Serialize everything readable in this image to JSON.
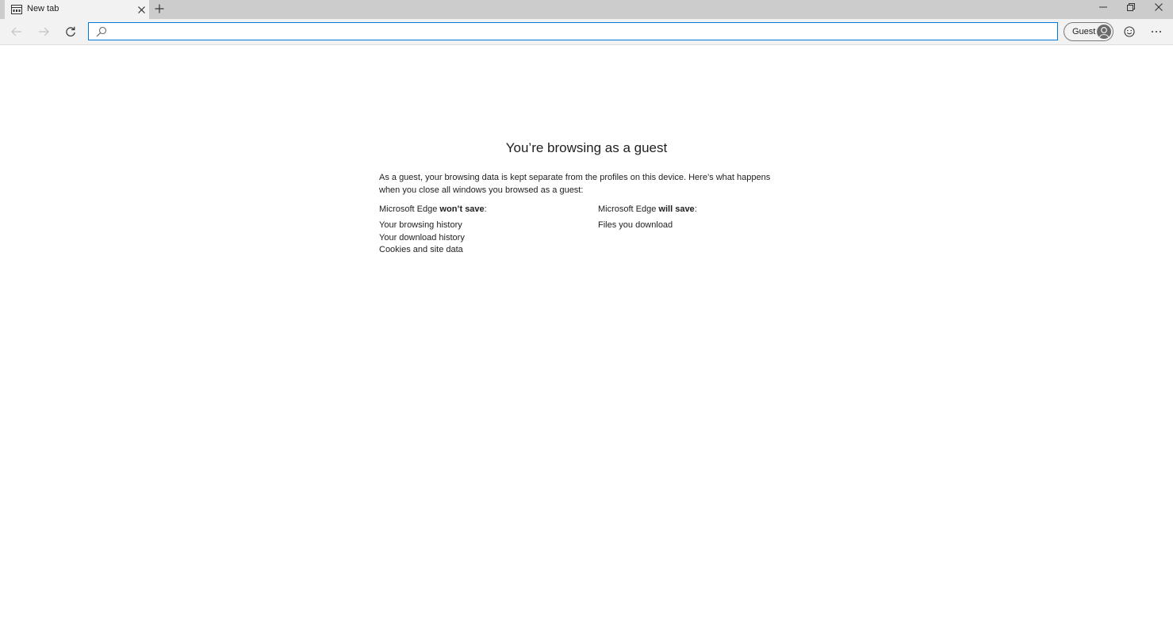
{
  "browser": {
    "tab": {
      "title": "New tab",
      "icon": "newtab-page-icon"
    },
    "new_tab_icon": "plus-icon",
    "window_controls": [
      "minimize-icon",
      "restore-icon",
      "close-icon"
    ],
    "address_bar": {
      "value": "",
      "placeholder": "",
      "icon": "search-icon"
    },
    "profile": {
      "label": "Guest",
      "icon": "avatar-icon"
    },
    "toolbar_icons": [
      "emoji-feedback-icon",
      "more-icon"
    ],
    "accent_color": "#0078d7"
  },
  "page": {
    "title": "You’re browsing as a guest",
    "intro": "As a guest, your browsing data is kept separate from the profiles on this device. Here’s what happens when you close all windows you browsed as a guest:",
    "wont_save": {
      "prefix": "Microsoft Edge ",
      "emphasis": "won’t save",
      "suffix": ":",
      "items": [
        "Your browsing history",
        "Your download history",
        "Cookies and site data"
      ]
    },
    "will_save": {
      "prefix": "Microsoft Edge ",
      "emphasis": "will save",
      "suffix": ":",
      "items": [
        "Files you download"
      ]
    }
  }
}
